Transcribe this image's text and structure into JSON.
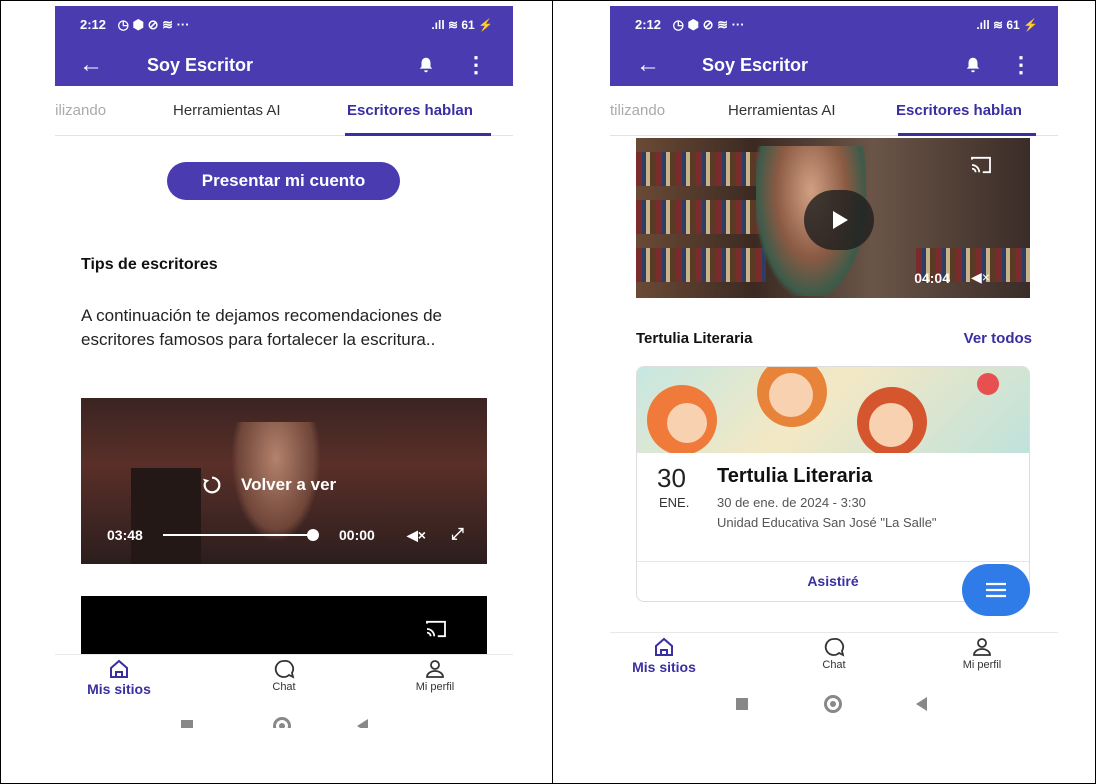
{
  "left_phone": {
    "status": {
      "time": "2:12",
      "icons_left": "◷ ⬢ ⊘ ≋ ···",
      "icons_right": ".ıll ≋ 61 ⚡",
      "battery": "61"
    },
    "appbar": {
      "title": "Soy Escritor"
    },
    "tabs": [
      {
        "label": "tilizando",
        "state": "faded"
      },
      {
        "label": "Herramientas AI",
        "state": "normal"
      },
      {
        "label": "Escritores hablan",
        "state": "active"
      }
    ],
    "present_button": "Presentar mi cuento",
    "section_title": "Tips de escritores",
    "paragraph": "A continuación te dejamos recomendaciones de escritores famosos para  fortalecer la escritura..",
    "video": {
      "replay_label": "Volver a ver",
      "current_time": "03:48",
      "end_time": "00:00"
    },
    "bottom_nav": [
      {
        "label": "Mis sitios",
        "icon": "home-icon",
        "active": true
      },
      {
        "label": "Chat",
        "icon": "chat-icon",
        "active": false
      },
      {
        "label": "Mi perfil",
        "icon": "profile-icon",
        "active": false
      }
    ]
  },
  "right_phone": {
    "status": {
      "time": "2:12",
      "icons_left": "◷ ⬢ ⊘ ≋ ···",
      "icons_right": ".ıll ≋ 61 ⚡",
      "battery": "61"
    },
    "appbar": {
      "title": "Soy Escritor"
    },
    "tabs": [
      {
        "label": "tilizando",
        "state": "faded"
      },
      {
        "label": "Herramientas AI",
        "state": "normal"
      },
      {
        "label": "Escritores hablan",
        "state": "active"
      }
    ],
    "video": {
      "duration": "04:04"
    },
    "section": {
      "title": "Tertulia Literaria",
      "see_all": "Ver todos"
    },
    "event": {
      "day": "30",
      "month": "ENE.",
      "title": "Tertulia Literaria",
      "date": "30 de ene. de 2024 - 3:30",
      "place": "Unidad Educativa San José \"La Salle\"",
      "attend_label": "Asistiré"
    },
    "bottom_nav": [
      {
        "label": "Mis sitios",
        "icon": "home-icon",
        "active": true
      },
      {
        "label": "Chat",
        "icon": "chat-icon",
        "active": false
      },
      {
        "label": "Mi perfil",
        "icon": "profile-icon",
        "active": false
      }
    ]
  },
  "colors": {
    "primary": "#4a3bb0",
    "accent": "#3a2fa0",
    "fab": "#2f7be8"
  }
}
